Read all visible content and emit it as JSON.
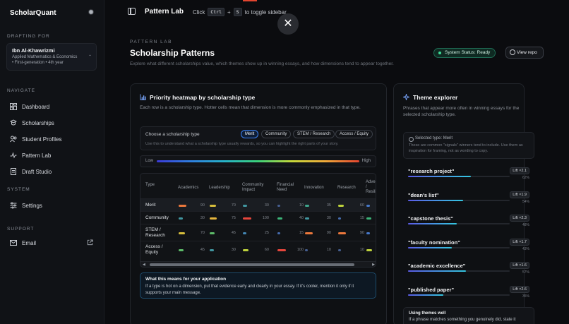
{
  "brand": "ScholarQuant",
  "sidebar": {
    "drafting_heading": "DRAFTING FOR",
    "profile": {
      "name": "Ibn Al-Khawrizmi",
      "line1": "Applied Mathematics & Economics",
      "line2": "• First-generation • 4th year"
    },
    "navigate_heading": "NAVIGATE",
    "navigate": [
      {
        "label": "Dashboard",
        "icon": "dashboard-icon"
      },
      {
        "label": "Scholarships",
        "icon": "scholarships-icon"
      },
      {
        "label": "Student Profiles",
        "icon": "profiles-icon"
      },
      {
        "label": "Pattern Lab",
        "icon": "pattern-lab-icon"
      },
      {
        "label": "Draft Studio",
        "icon": "draft-studio-icon"
      }
    ],
    "system_heading": "SYSTEM",
    "settings_label": "Settings",
    "support_heading": "SUPPORT",
    "email_label": "Email"
  },
  "topbar": {
    "title": "Pattern Lab",
    "hint_click": "Click",
    "hint_key1": "Ctrl",
    "hint_plus": "+",
    "hint_key2": "S",
    "hint_suffix": "to toggle sidebar"
  },
  "header": {
    "eyebrow": "PATTERN LAB",
    "title": "Scholarship Patterns",
    "subtitle": "Explore what different scholarships value, which themes show up in winning essays, and how dimensions tend to appear together.",
    "status": "System Status: Ready",
    "view_repo": "View repo"
  },
  "heatmap": {
    "title": "Priority heatmap by scholarship type",
    "desc": "Each row is a scholarship type. Hotter cells mean that dimension is more commonly emphasized in that type.",
    "chooser_label": "Choose a scholarship type",
    "chooser_hint": "Use this to understand what a scholarship type usually rewards, so you can highlight the right parts of your story.",
    "types": [
      "Merit",
      "Community",
      "STEM / Research",
      "Access / Equity"
    ],
    "selected_type": "Merit",
    "legend_low": "Low",
    "legend_high": "High",
    "col_type": "Type",
    "columns": [
      "Academics",
      "Leadership",
      "Community Impact",
      "Financial Need",
      "Innovation",
      "Research",
      "Adversity / Resilience"
    ],
    "columns_visible": [
      "Academics",
      "Leadership",
      "Community\nImpact",
      "Financial\nNeed",
      "Innovation",
      "Research",
      "Adver\n/\nResili"
    ],
    "rows": [
      {
        "label": "Merit",
        "values": [
          90,
          70,
          30,
          10,
          35,
          60,
          20
        ]
      },
      {
        "label": "Community",
        "values": [
          30,
          75,
          100,
          40,
          30,
          15,
          40
        ]
      },
      {
        "label": "STEM /\nResearch",
        "values": [
          70,
          45,
          25,
          15,
          90,
          90,
          20
        ]
      },
      {
        "label": "Access /\nEquity",
        "values": [
          45,
          30,
          60,
          100,
          10,
          10,
          60
        ]
      }
    ],
    "meaning_title": "What this means for your application",
    "meaning_text": "If a type is hot on a dimension, put that evidence early and clearly in your essay. If it's cooler, mention it only if it supports your main message."
  },
  "themes": {
    "title": "Theme explorer",
    "desc": "Phrases that appear more often in winning essays for the selected scholarship type.",
    "selected_label": "Selected type: Merit",
    "selected_note": "These are common \"signals\" winners tend to include. Use them as inspiration for framing, not as wording to copy.",
    "phrases": [
      {
        "text": "\"research project\"",
        "lift": "Lift ×2.1",
        "pct": 62
      },
      {
        "text": "\"dean's list\"",
        "lift": "Lift ×1.9",
        "pct": 54
      },
      {
        "text": "\"capstone thesis\"",
        "lift": "Lift ×2.3",
        "pct": 48
      },
      {
        "text": "\"faculty nomination\"",
        "lift": "Lift ×1.7",
        "pct": 43
      },
      {
        "text": "\"academic excellence\"",
        "lift": "Lift ×1.6",
        "pct": 57
      },
      {
        "text": "\"published paper\"",
        "lift": "Lift ×2.6",
        "pct": 35
      }
    ],
    "using_title": "Using themes well",
    "using_text": "If a phrase matches something you genuinely did, state it"
  },
  "colors": {
    "accent": "#3b82f6",
    "status_green": "#3ddc97",
    "close_bg": "#2a2c31"
  }
}
